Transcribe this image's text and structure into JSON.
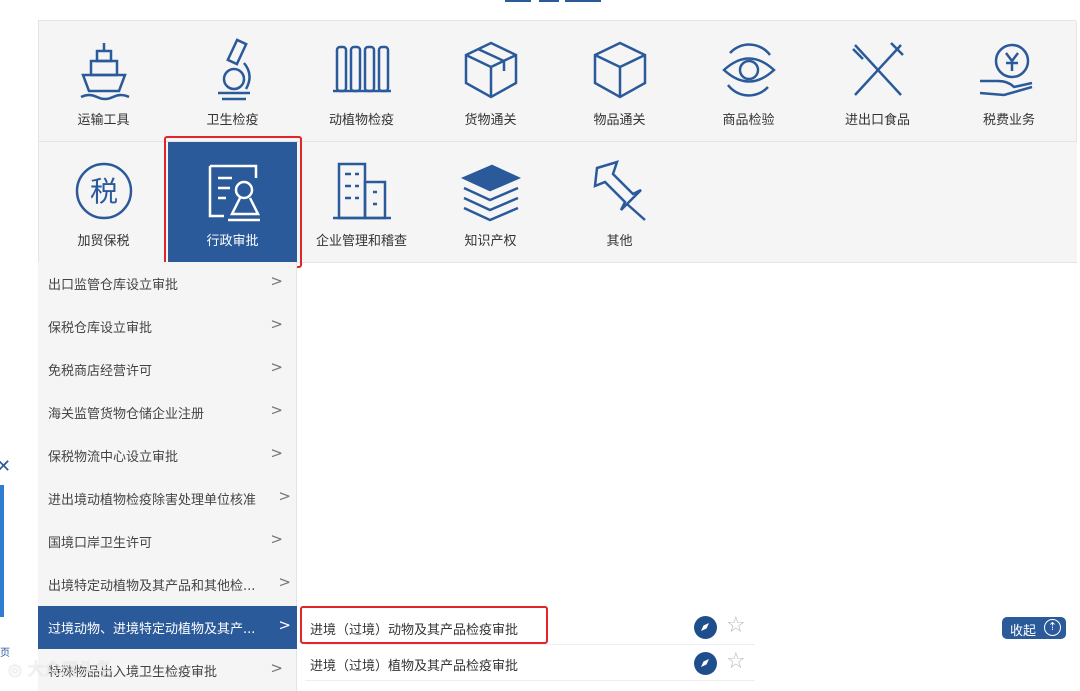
{
  "categories": [
    {
      "label": "运输工具",
      "icon": "ship-icon"
    },
    {
      "label": "卫生检疫",
      "icon": "microscope-icon"
    },
    {
      "label": "动植物检疫",
      "icon": "fence-icon"
    },
    {
      "label": "货物通关",
      "icon": "box-icon"
    },
    {
      "label": "物品通关",
      "icon": "cube-icon"
    },
    {
      "label": "商品检验",
      "icon": "eye-icon"
    },
    {
      "label": "进出口食品",
      "icon": "fork-knife-icon"
    },
    {
      "label": "税费业务",
      "icon": "yen-hand-icon"
    },
    {
      "label": "加贸保税",
      "icon": "tax-circle-icon"
    },
    {
      "label": "行政审批",
      "icon": "approval-document-icon",
      "active": true
    },
    {
      "label": "企业管理和稽查",
      "icon": "building-icon"
    },
    {
      "label": "知识产权",
      "icon": "books-icon"
    },
    {
      "label": "其他",
      "icon": "pin-icon"
    }
  ],
  "tax_glyph": "税",
  "menu": [
    {
      "label": "出口监管仓库设立审批"
    },
    {
      "label": "保税仓库设立审批"
    },
    {
      "label": "免税商店经营许可"
    },
    {
      "label": "海关监管货物仓储企业注册"
    },
    {
      "label": "保税物流中心设立审批"
    },
    {
      "label": "进出境动植物检疫除害处理单位核准"
    },
    {
      "label": "国境口岸卫生许可"
    },
    {
      "label": "出境特定动植物及其产品和其他检..."
    },
    {
      "label": "过境动物、进境特定动植物及其产...",
      "active": true
    },
    {
      "label": "特殊物品出入境卫生检疫审批"
    }
  ],
  "chevron": ">",
  "sub_items": [
    {
      "label": "进境（过境）动物及其产品检疫审批"
    },
    {
      "label": "进境（过境）植物及其产品检疫审批"
    }
  ],
  "star_glyph": "☆",
  "collapse": {
    "label": "收起",
    "icon": "⇡"
  },
  "left_widget": {
    "close": "✕",
    "page": "页"
  },
  "watermark": "大众网头条",
  "colors": {
    "brand": "#2b5a9b",
    "highlight": "#e0262b",
    "tile_bg": "#f5f5f5"
  }
}
